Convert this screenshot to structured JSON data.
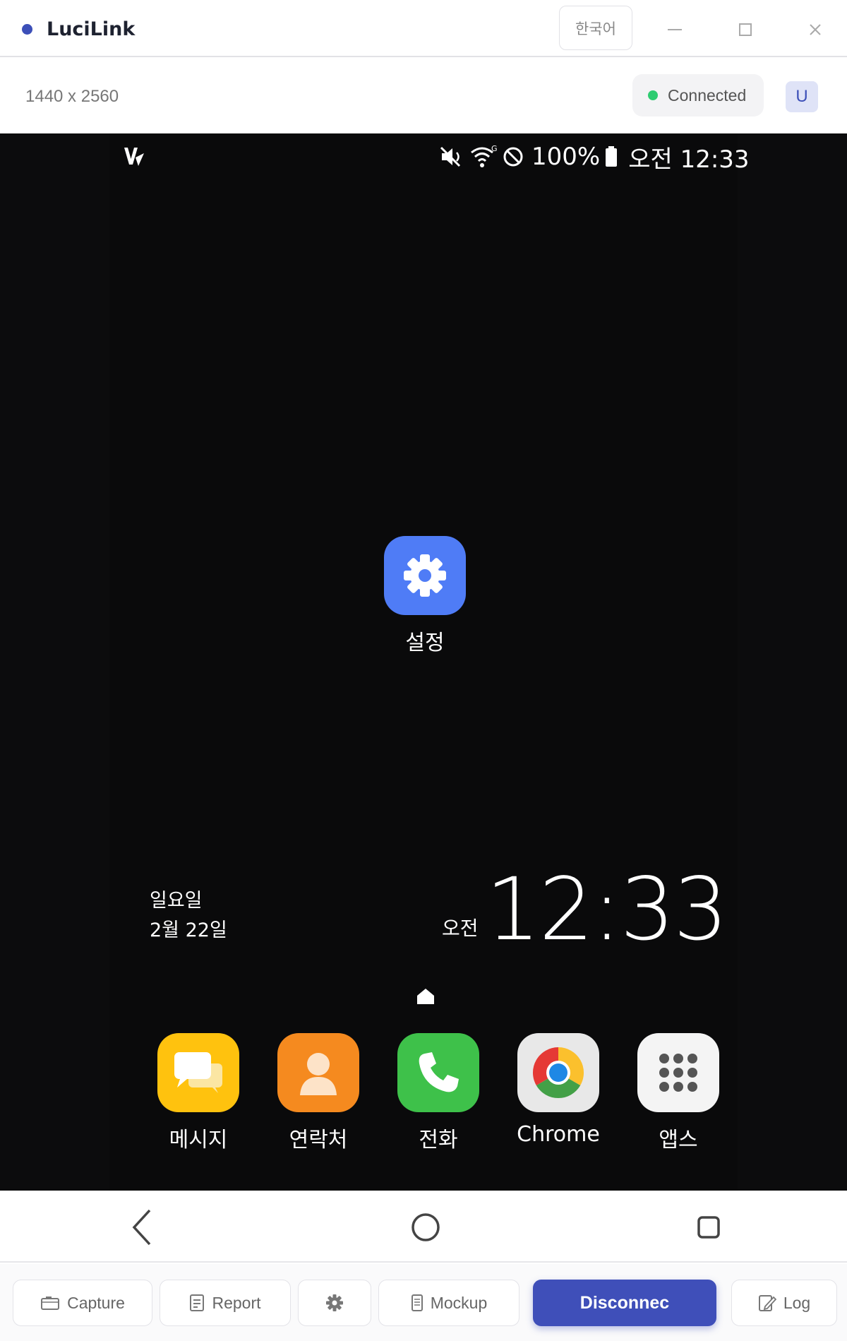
{
  "app": {
    "title": "LuciLink",
    "accent": "#3c4fb8"
  },
  "titlebar": {
    "language_label": "한국어"
  },
  "infobar": {
    "resolution": "1440 x 2560",
    "status": "Connected",
    "status_color": "#2ecc71",
    "avatar_letter": "U"
  },
  "device": {
    "statusbar": {
      "battery": "100%",
      "time": "오전 12:33",
      "icons": [
        "v-logo-icon",
        "mute-icon",
        "wifi-icon",
        "do-not-disturb-icon",
        "battery-icon"
      ]
    },
    "home_app": {
      "label": "설정",
      "icon": "settings-gear-icon"
    },
    "date_widget": {
      "weekday": "일요일",
      "date": "2월 22일"
    },
    "clock": {
      "ampm": "오전",
      "time": "12:33"
    },
    "dock": [
      {
        "label": "메시지",
        "icon": "messages-icon"
      },
      {
        "label": "연락처",
        "icon": "contacts-icon"
      },
      {
        "label": "전화",
        "icon": "phone-icon"
      },
      {
        "label": "Chrome",
        "icon": "chrome-icon"
      },
      {
        "label": "앱스",
        "icon": "apps-grid-icon"
      }
    ]
  },
  "navbar": {
    "items": [
      "back-icon",
      "home-icon",
      "recent-apps-icon"
    ]
  },
  "toolbar": {
    "capture": "Capture",
    "report": "Report",
    "mockup": "Mockup",
    "disconnect": "Disconnec",
    "log": "Log"
  }
}
